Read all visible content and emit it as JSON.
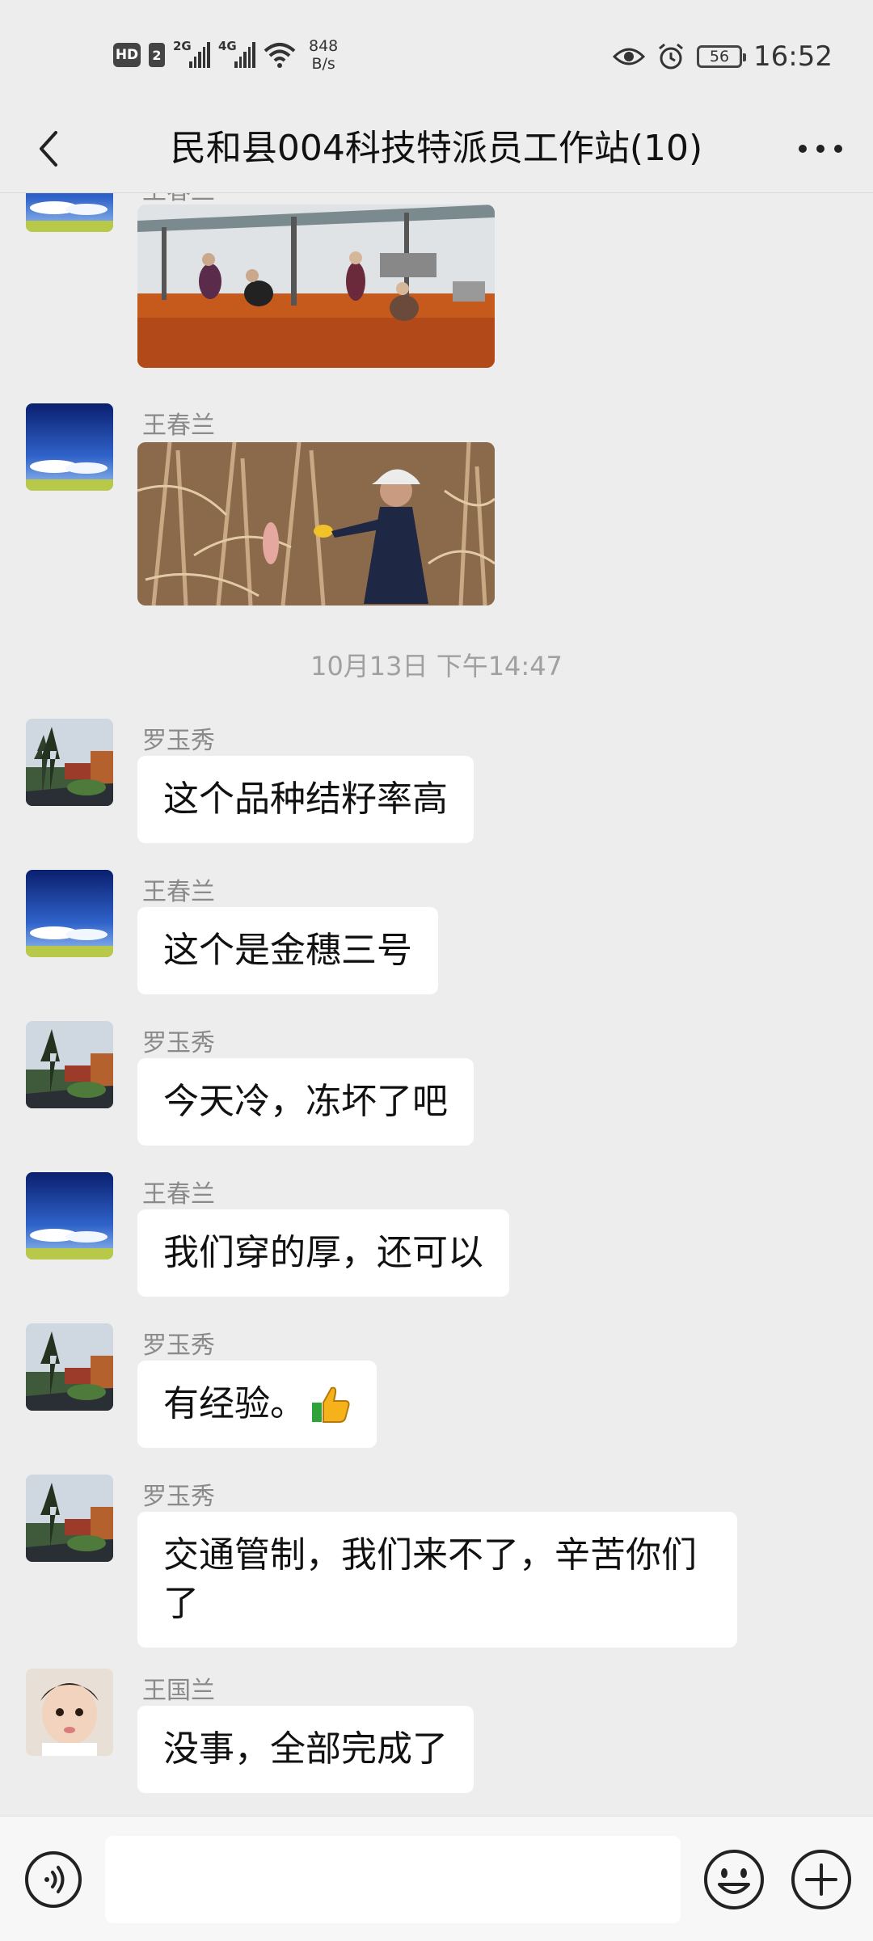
{
  "status_bar": {
    "hd": "HD",
    "sim": "2",
    "net1": "2G",
    "net2": "4G",
    "speed_value": "848",
    "speed_unit": "B/s",
    "battery": "56",
    "time": "16:52"
  },
  "header": {
    "title": "民和县004科技特派员工作站(10)"
  },
  "messages": [
    {
      "sender": "王春兰",
      "type": "image"
    },
    {
      "sender": "王春兰",
      "type": "image"
    },
    {
      "timestamp": "10月13日 下午14:47"
    },
    {
      "sender": "罗玉秀",
      "text": "这个品种结籽率高"
    },
    {
      "sender": "王春兰",
      "text": "这个是金穗三号"
    },
    {
      "sender": "罗玉秀",
      "text": "今天冷，冻坏了吧"
    },
    {
      "sender": "王春兰",
      "text": "我们穿的厚，还可以"
    },
    {
      "sender": "罗玉秀",
      "text": "有经验。"
    },
    {
      "sender": "罗玉秀",
      "text": "交通管制，我们来不了，辛苦你们了"
    },
    {
      "sender": "王国兰",
      "text": "没事，全部完成了"
    }
  ],
  "input": {
    "placeholder": ""
  },
  "colors": {
    "background": "#ededed",
    "bubble": "#ffffff",
    "sender_name": "#8a8a8a"
  }
}
